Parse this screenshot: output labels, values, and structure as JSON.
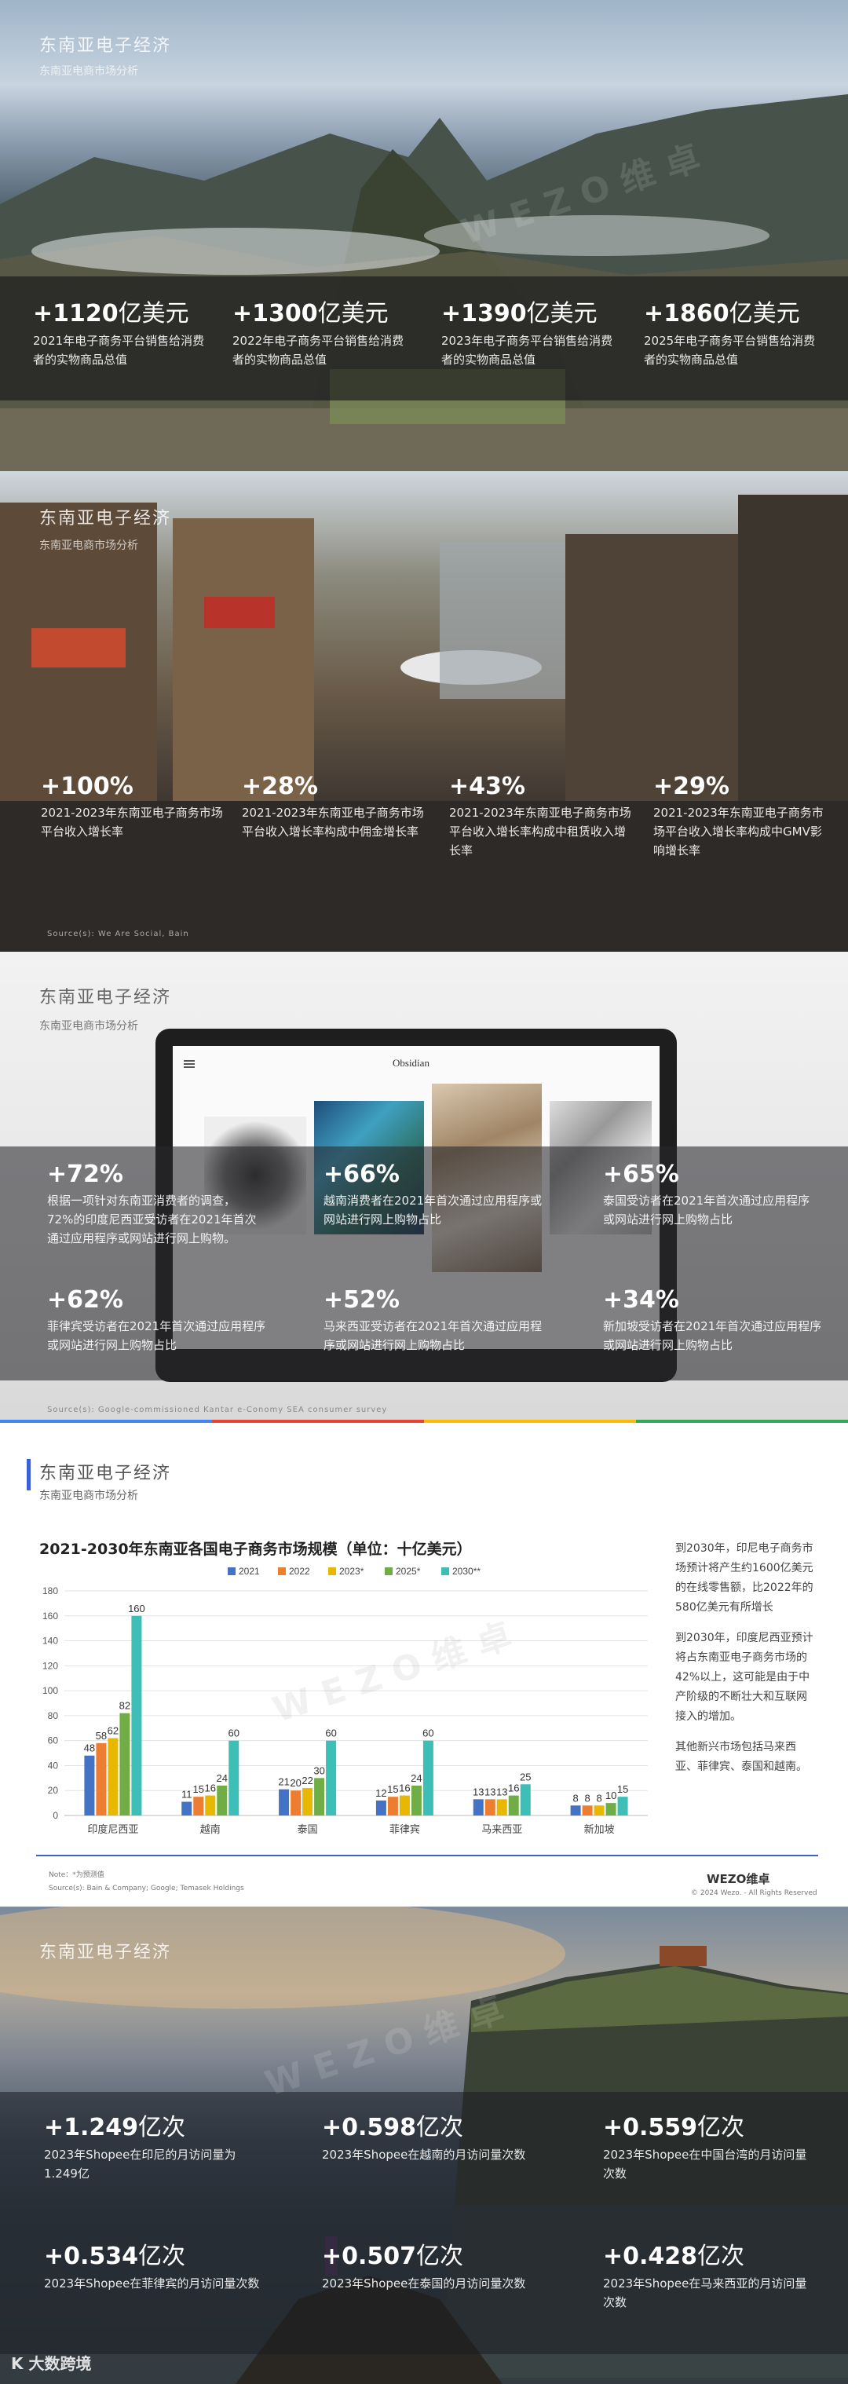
{
  "panel1": {
    "title": "东南亚电子经济",
    "subtitle": "东南亚电商市场分析",
    "stats": [
      {
        "num": "+1120",
        "unit": "亿美元",
        "desc": "2021年电子商务平台销售给消费者的实物商品总值"
      },
      {
        "num": "+1300",
        "unit": "亿美元",
        "desc": "2022年电子商务平台销售给消费者的实物商品总值"
      },
      {
        "num": "+1390",
        "unit": "亿美元",
        "desc": "2023年电子商务平台销售给消费者的实物商品总值"
      },
      {
        "num": "+1860",
        "unit": "亿美元",
        "desc": "2025年电子商务平台销售给消费者的实物商品总值"
      }
    ]
  },
  "panel2": {
    "title": "东南亚电子经济",
    "subtitle": "东南亚电商市场分析",
    "stats": [
      {
        "num": "+100%",
        "desc": "2021-2023年东南亚电子商务市场平台收入增长率"
      },
      {
        "num": "+28%",
        "desc": "2021-2023年东南亚电子商务市场平台收入增长率构成中佣金增长率"
      },
      {
        "num": "+43%",
        "desc": "2021-2023年东南亚电子商务市场平台收入增长率构成中租赁收入增长率"
      },
      {
        "num": "+29%",
        "desc": "2021-2023年东南亚电子商务市场平台收入增长率构成中GMV影响增长率"
      }
    ],
    "source": "Source(s): We Are Social, Bain"
  },
  "panel3": {
    "title": "东南亚电子经济",
    "subtitle": "东南亚电商市场分析",
    "screen_brand": "Obsidian",
    "stats": [
      {
        "num": "+72%",
        "desc": "根据一项针对东南亚消费者的调查，72%的印度尼西亚受访者在2021年首次通过应用程序或网站进行网上购物。"
      },
      {
        "num": "+66%",
        "desc": "越南消费者在2021年首次通过应用程序或网站进行网上购物占比"
      },
      {
        "num": "+65%",
        "desc": "泰国受访者在2021年首次通过应用程序或网站进行网上购物占比"
      },
      {
        "num": "+62%",
        "desc": "菲律宾受访者在2021年首次通过应用程序或网站进行网上购物占比"
      },
      {
        "num": "+52%",
        "desc": "马来西亚受访者在2021年首次通过应用程序或网站进行网上购物占比"
      },
      {
        "num": "+34%",
        "desc": "新加坡受访者在2021年首次通过应用程序或网站进行网上购物占比"
      }
    ],
    "source": "Source(s): Google-commissioned Kantar e-Conomy SEA consumer survey"
  },
  "panel4": {
    "title": "东南亚电子经济",
    "subtitle": "东南亚电商市场分析",
    "side_paragraphs": [
      "到2030年，印尼电子商务市场预计将产生约1600亿美元的在线零售额，比2022年的580亿美元有所增长",
      "到2030年，印度尼西亚预计将占东南亚电子商务市场的42%以上，这可能是由于中产阶级的不断壮大和互联网接入的增加。",
      "其他新兴市场包括马来西亚、菲律宾、泰国和越南。"
    ],
    "note": "Note：*为预测值",
    "source": "Source(s): Bain & Company; Google; Temasek Holdings",
    "logo": "WEZO维卓",
    "copyright": "© 2024 Wezo. - All Rights Reserved"
  },
  "chart_data": {
    "type": "bar",
    "title": "2021-2030年东南亚各国电子商务市场规模（单位：十亿美元）",
    "categories": [
      "印度尼西亚",
      "越南",
      "泰国",
      "菲律宾",
      "马来西亚",
      "新加坡"
    ],
    "series": [
      {
        "name": "2021",
        "color": "#4472c4",
        "values": [
          48,
          11,
          21,
          12,
          13,
          8
        ]
      },
      {
        "name": "2022",
        "color": "#ed7d31",
        "values": [
          58,
          15,
          20,
          15,
          13,
          8
        ]
      },
      {
        "name": "2023*",
        "color": "#e8b700",
        "values": [
          62,
          16,
          22,
          16,
          13,
          8
        ]
      },
      {
        "name": "2025*",
        "color": "#70ad47",
        "values": [
          82,
          24,
          30,
          24,
          16,
          10
        ]
      },
      {
        "name": "2030**",
        "color": "#3dbfb8",
        "values": [
          160,
          60,
          60,
          60,
          25,
          15
        ]
      }
    ],
    "ylim": [
      0,
      180
    ],
    "yticks": [
      0,
      20,
      40,
      60,
      80,
      100,
      120,
      140,
      160,
      180
    ],
    "grid": true,
    "legend": "top-center"
  },
  "panel5": {
    "title": "东南亚电子经济",
    "stats": [
      {
        "num": "+1.249",
        "unit": "亿次",
        "desc": "2023年Shopee在印尼的月访问量为1.249亿"
      },
      {
        "num": "+0.598",
        "unit": "亿次",
        "desc": "2023年Shopee在越南的月访问量次数"
      },
      {
        "num": "+0.559",
        "unit": "亿次",
        "desc": "2023年Shopee在中国台湾的月访问量次数"
      },
      {
        "num": "+0.534",
        "unit": "亿次",
        "desc": "2023年Shopee在菲律宾的月访问量次数"
      },
      {
        "num": "+0.507",
        "unit": "亿次",
        "desc": "2023年Shopee在泰国的月访问量次数"
      },
      {
        "num": "+0.428",
        "unit": "亿次",
        "desc": "2023年Shopee在马来西亚的月访问量次数"
      }
    ],
    "bottom_logo": "K 大数跨境"
  },
  "watermark": "WEZO维卓"
}
